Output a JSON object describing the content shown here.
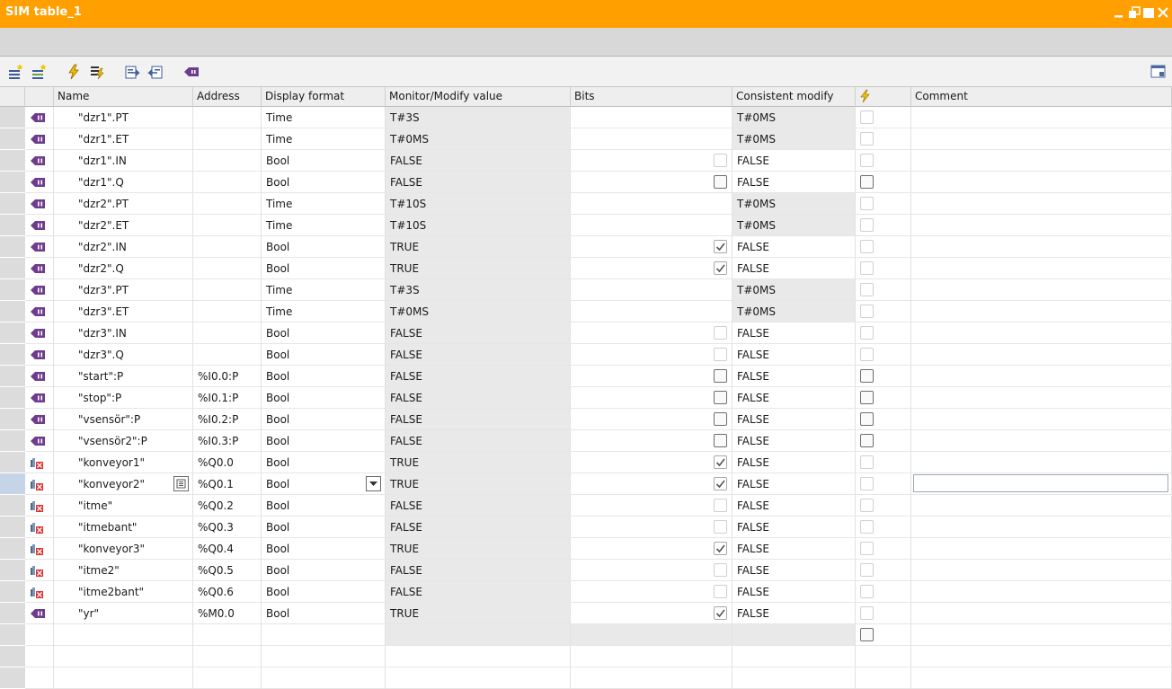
{
  "window": {
    "title": "SIM table_1",
    "controls": [
      "minimize-icon",
      "restore-icon",
      "maximize-icon",
      "close-icon"
    ]
  },
  "columns": {
    "name": "Name",
    "address": "Address",
    "display_format": "Display format",
    "monitor_value": "Monitor/Modify value",
    "bits": "Bits",
    "consistent_modify": "Consistent modify",
    "comment": "Comment"
  },
  "rows": [
    {
      "name": "\"dzr1\".PT",
      "address": "",
      "format": "Time",
      "value": "T#3S",
      "bits": "none",
      "consistent": "T#0MS",
      "kind": "io"
    },
    {
      "name": "\"dzr1\".ET",
      "address": "",
      "format": "Time",
      "value": "T#0MS",
      "bits": "none",
      "consistent": "T#0MS",
      "kind": "io"
    },
    {
      "name": "\"dzr1\".IN",
      "address": "",
      "format": "Bool",
      "value": "FALSE",
      "bits": "unchecked-dim",
      "consistent": "FALSE",
      "kind": "io"
    },
    {
      "name": "\"dzr1\".Q",
      "address": "",
      "format": "Bool",
      "value": "FALSE",
      "bits": "unchecked",
      "consistent": "FALSE",
      "kind": "io"
    },
    {
      "name": "\"dzr2\".PT",
      "address": "",
      "format": "Time",
      "value": "T#10S",
      "bits": "none",
      "consistent": "T#0MS",
      "kind": "io"
    },
    {
      "name": "\"dzr2\".ET",
      "address": "",
      "format": "Time",
      "value": "T#10S",
      "bits": "none",
      "consistent": "T#0MS",
      "kind": "io"
    },
    {
      "name": "\"dzr2\".IN",
      "address": "",
      "format": "Bool",
      "value": "TRUE",
      "bits": "checked",
      "consistent": "FALSE",
      "kind": "io"
    },
    {
      "name": "\"dzr2\".Q",
      "address": "",
      "format": "Bool",
      "value": "TRUE",
      "bits": "checked",
      "consistent": "FALSE",
      "kind": "io"
    },
    {
      "name": "\"dzr3\".PT",
      "address": "",
      "format": "Time",
      "value": "T#3S",
      "bits": "none",
      "consistent": "T#0MS",
      "kind": "io"
    },
    {
      "name": "\"dzr3\".ET",
      "address": "",
      "format": "Time",
      "value": "T#0MS",
      "bits": "none",
      "consistent": "T#0MS",
      "kind": "io"
    },
    {
      "name": "\"dzr3\".IN",
      "address": "",
      "format": "Bool",
      "value": "FALSE",
      "bits": "unchecked-dim",
      "consistent": "FALSE",
      "kind": "io"
    },
    {
      "name": "\"dzr3\".Q",
      "address": "",
      "format": "Bool",
      "value": "FALSE",
      "bits": "unchecked-dim",
      "consistent": "FALSE",
      "kind": "io"
    },
    {
      "name": "\"start\":P",
      "address": "%I0.0:P",
      "format": "Bool",
      "value": "FALSE",
      "bits": "unchecked",
      "consistent": "FALSE",
      "kind": "io"
    },
    {
      "name": "\"stop\":P",
      "address": "%I0.1:P",
      "format": "Bool",
      "value": "FALSE",
      "bits": "unchecked",
      "consistent": "FALSE",
      "kind": "io"
    },
    {
      "name": "\"vsensör\":P",
      "address": "%I0.2:P",
      "format": "Bool",
      "value": "FALSE",
      "bits": "unchecked",
      "consistent": "FALSE",
      "kind": "io"
    },
    {
      "name": "\"vsensör2\":P",
      "address": "%I0.3:P",
      "format": "Bool",
      "value": "FALSE",
      "bits": "unchecked",
      "consistent": "FALSE",
      "kind": "io"
    },
    {
      "name": "\"konveyor1\"",
      "address": "%Q0.0",
      "format": "Bool",
      "value": "TRUE",
      "bits": "checked",
      "consistent": "FALSE",
      "kind": "out"
    },
    {
      "name": "\"konveyor2\"",
      "address": "%Q0.1",
      "format": "Bool",
      "value": "TRUE",
      "bits": "checked",
      "consistent": "FALSE",
      "kind": "out",
      "selected": true
    },
    {
      "name": "\"itme\"",
      "address": "%Q0.2",
      "format": "Bool",
      "value": "FALSE",
      "bits": "unchecked-dim",
      "consistent": "FALSE",
      "kind": "out"
    },
    {
      "name": "\"itmebant\"",
      "address": "%Q0.3",
      "format": "Bool",
      "value": "FALSE",
      "bits": "unchecked-dim",
      "consistent": "FALSE",
      "kind": "out"
    },
    {
      "name": "\"konveyor3\"",
      "address": "%Q0.4",
      "format": "Bool",
      "value": "TRUE",
      "bits": "checked",
      "consistent": "FALSE",
      "kind": "out"
    },
    {
      "name": "\"itme2\"",
      "address": "%Q0.5",
      "format": "Bool",
      "value": "FALSE",
      "bits": "unchecked-dim",
      "consistent": "FALSE",
      "kind": "out"
    },
    {
      "name": "\"itme2bant\"",
      "address": "%Q0.6",
      "format": "Bool",
      "value": "FALSE",
      "bits": "unchecked-dim",
      "consistent": "FALSE",
      "kind": "out"
    },
    {
      "name": "\"yr\"",
      "address": "%M0.0",
      "format": "Bool",
      "value": "TRUE",
      "bits": "checked",
      "consistent": "FALSE",
      "kind": "io"
    }
  ],
  "toolbar_icons": [
    "add-row-icon",
    "insert-row-icon",
    "modify-icon",
    "modify-all-icon",
    "export-icon",
    "import-icon",
    "io-tag-icon"
  ]
}
